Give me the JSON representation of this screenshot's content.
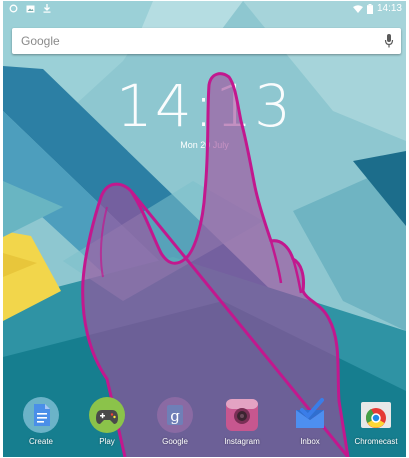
{
  "status_bar": {
    "left_icons": [
      "circle-notification-icon",
      "image-notification-icon",
      "download-notification-icon"
    ],
    "right_icons": [
      "wifi-icon",
      "battery-icon"
    ],
    "time": "14:13"
  },
  "search": {
    "placeholder": "Google",
    "mic_icon": "mic-icon"
  },
  "clock": {
    "time": "14:13",
    "date": "Mon 20 July"
  },
  "dock": {
    "apps": [
      {
        "label": "Create",
        "icon": "create-icon"
      },
      {
        "label": "Play",
        "icon": "play-games-icon"
      },
      {
        "label": "Google",
        "icon": "google-icon"
      },
      {
        "label": "Instagram",
        "icon": "instagram-icon"
      },
      {
        "label": "Inbox",
        "icon": "inbox-icon"
      },
      {
        "label": "Chromecast",
        "icon": "chromecast-icon"
      }
    ]
  },
  "colors": {
    "wallpaper_base": "#8ec7d0",
    "wallpaper_dark": "#1f6d8c",
    "wallpaper_stripe": "#3a8fb0",
    "accent_yellow": "#f2d64b",
    "hand_fill": "#a24e9d",
    "hand_outline": "#c2188e"
  }
}
